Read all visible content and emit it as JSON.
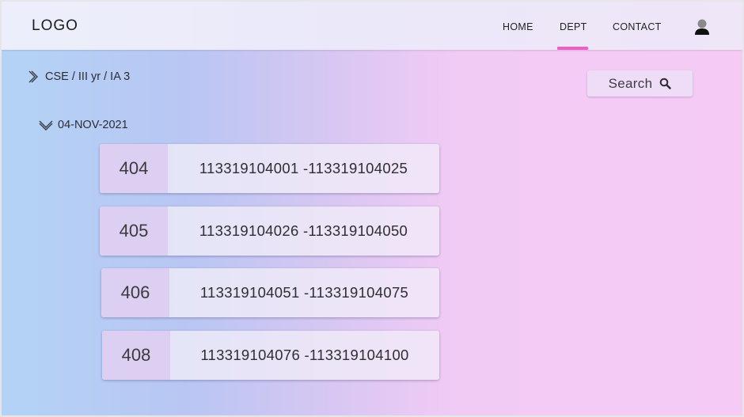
{
  "header": {
    "logo": "LOGO",
    "nav": [
      {
        "label": "HOME",
        "active": false
      },
      {
        "label": "DEPT",
        "active": true
      },
      {
        "label": "CONTACT",
        "active": false
      }
    ],
    "avatar_icon": "user-icon",
    "active_color": "#ee5fc6"
  },
  "breadcrumb": {
    "icon": "chevron-right-icon",
    "text": "CSE / III yr / IA 3"
  },
  "search": {
    "label": "Search",
    "icon": "search-icon"
  },
  "date_group": {
    "icon": "chevron-down-icon",
    "label": "04-NOV-2021",
    "rooms": [
      {
        "room": "404",
        "range": "113319104001 -113319104025"
      },
      {
        "room": "405",
        "range": "113319104026 -113319104050"
      },
      {
        "room": "406",
        "range": "113319104051 -113319104075"
      },
      {
        "room": "408",
        "range": "113319104076 -113319104100"
      }
    ]
  }
}
